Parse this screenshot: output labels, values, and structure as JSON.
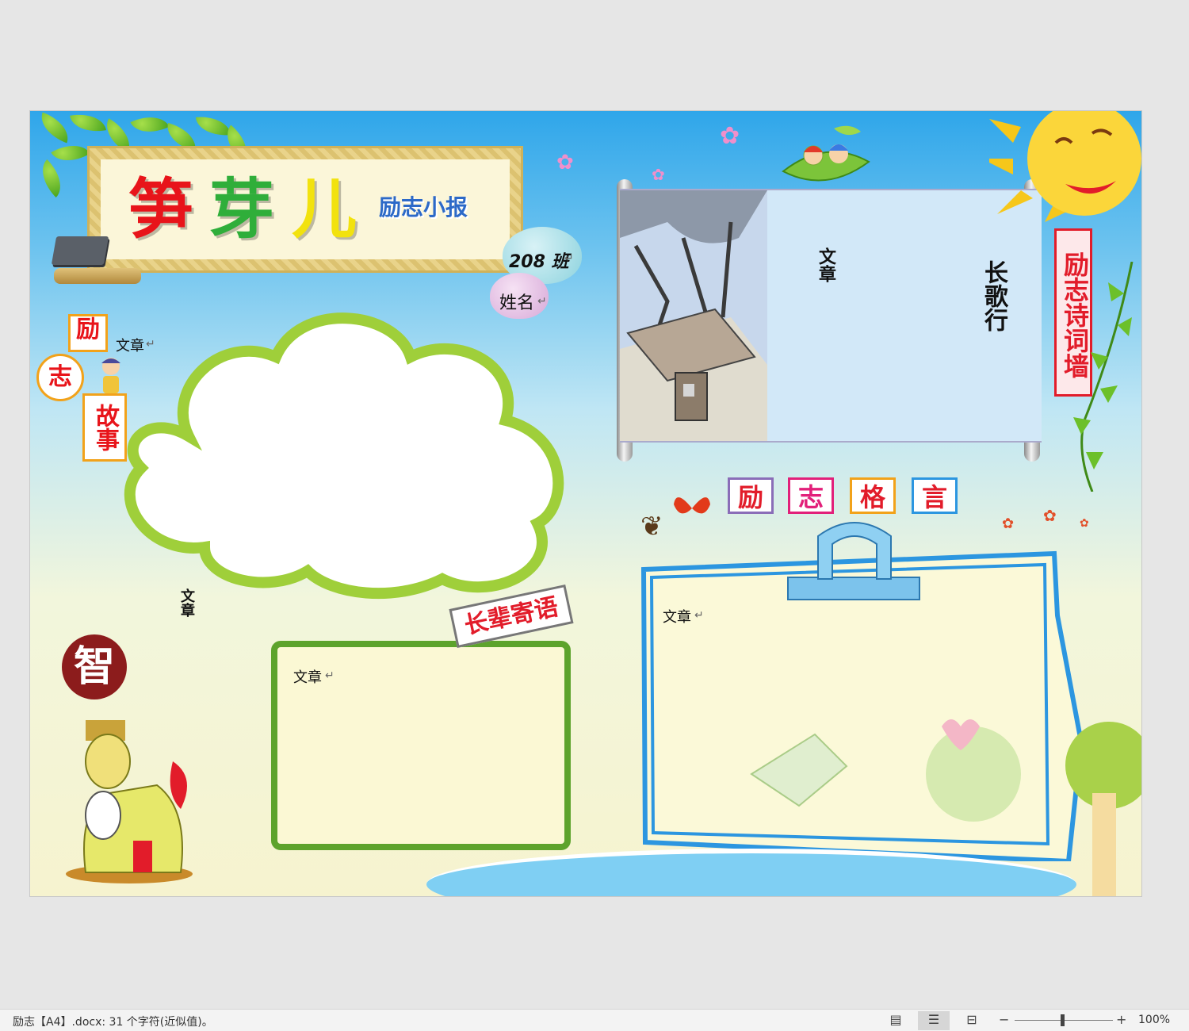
{
  "newspaper": {
    "title_chars": [
      "笋",
      "芽",
      "儿"
    ],
    "subtitle": "励志小报",
    "class_label": "208 班",
    "name_label": "姓名",
    "story_chars": [
      "励",
      "志",
      "故事"
    ],
    "placeholder_article": "文章",
    "vertical_article": "文章",
    "poem_title": "长歌行",
    "poem_article": "文章",
    "wall_label": "励志诗词墙",
    "motto_chars": [
      "励",
      "志",
      "格",
      "言"
    ],
    "elders_sign": "长辈寄语",
    "zhi_badge": "智",
    "colors": {
      "title_1": "#e8141a",
      "title_2": "#2fae3a",
      "title_3": "#f2e20e",
      "accent_red": "#e21c2a",
      "accent_blue": "#2c96e0",
      "accent_green": "#5da32c"
    }
  },
  "statusbar": {
    "doc_info": "励志【A4】.docx: 31 个字符(近似值)。",
    "view_read_icon": "book-icon",
    "view_print_icon": "page-layout-icon",
    "view_web_icon": "web-layout-icon",
    "zoom_minus": "−",
    "zoom_plus": "+",
    "zoom_level": "100%"
  }
}
